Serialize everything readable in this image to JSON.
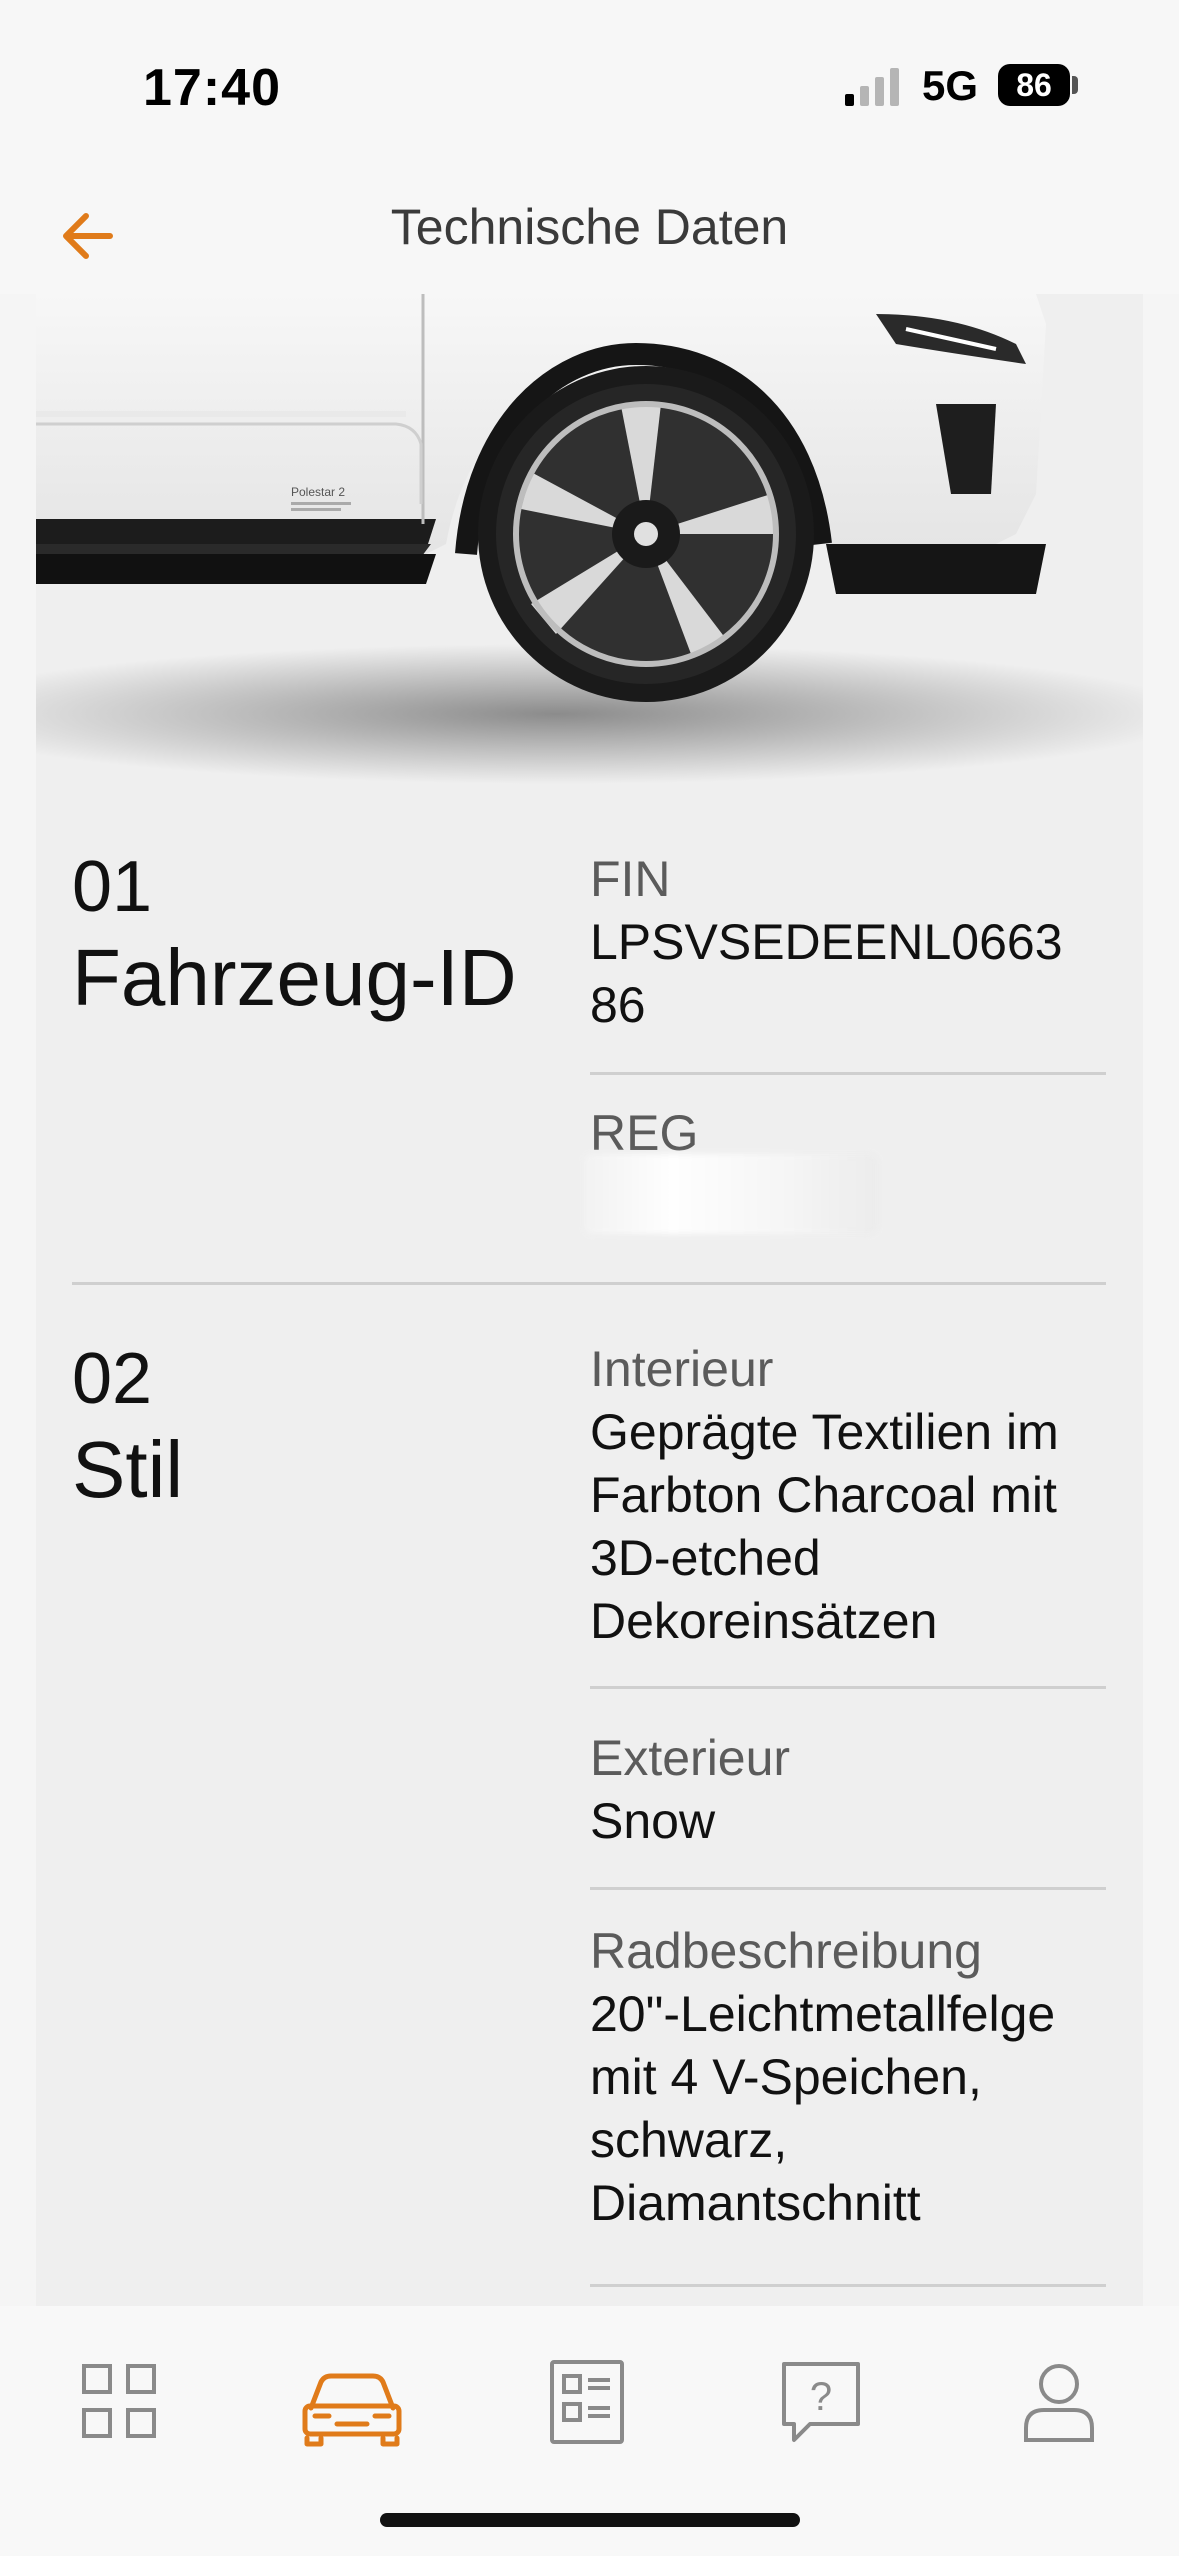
{
  "status_bar": {
    "time": "17:40",
    "network": "5G",
    "battery": "86"
  },
  "header": {
    "title": "Technische Daten"
  },
  "sections": [
    {
      "number": "01",
      "title": "Fahrzeug-ID",
      "fields": [
        {
          "label": "FIN",
          "value_line1": "LPSVSEDEENL0663",
          "value_line2": "86"
        },
        {
          "label": "REG",
          "value": ""
        }
      ]
    },
    {
      "number": "02",
      "title": "Stil",
      "fields": [
        {
          "label": "Interieur",
          "value_lines": [
            "Geprägte Textilien im",
            "Farbton Charcoal mit",
            "3D-etched",
            "Dekoreinsätzen"
          ]
        },
        {
          "label": "Exterieur",
          "value_lines": [
            "Snow"
          ]
        },
        {
          "label": "Radbeschreibung",
          "value_lines": [
            "20\"-Leichtmetallfelge",
            "mit 4 V-Speichen,",
            "schwarz,",
            "Diamantschnitt"
          ]
        }
      ]
    }
  ],
  "hero": {
    "badge_text": "Polestar 2"
  },
  "tabbar": {
    "items": [
      {
        "icon": "grid-icon"
      },
      {
        "icon": "car-icon",
        "active": true
      },
      {
        "icon": "document-icon"
      },
      {
        "icon": "help-icon",
        "glyph": "?"
      },
      {
        "icon": "profile-icon"
      }
    ]
  },
  "colors": {
    "accent": "#e07b1a",
    "icon_gray": "#8a8a8a"
  }
}
